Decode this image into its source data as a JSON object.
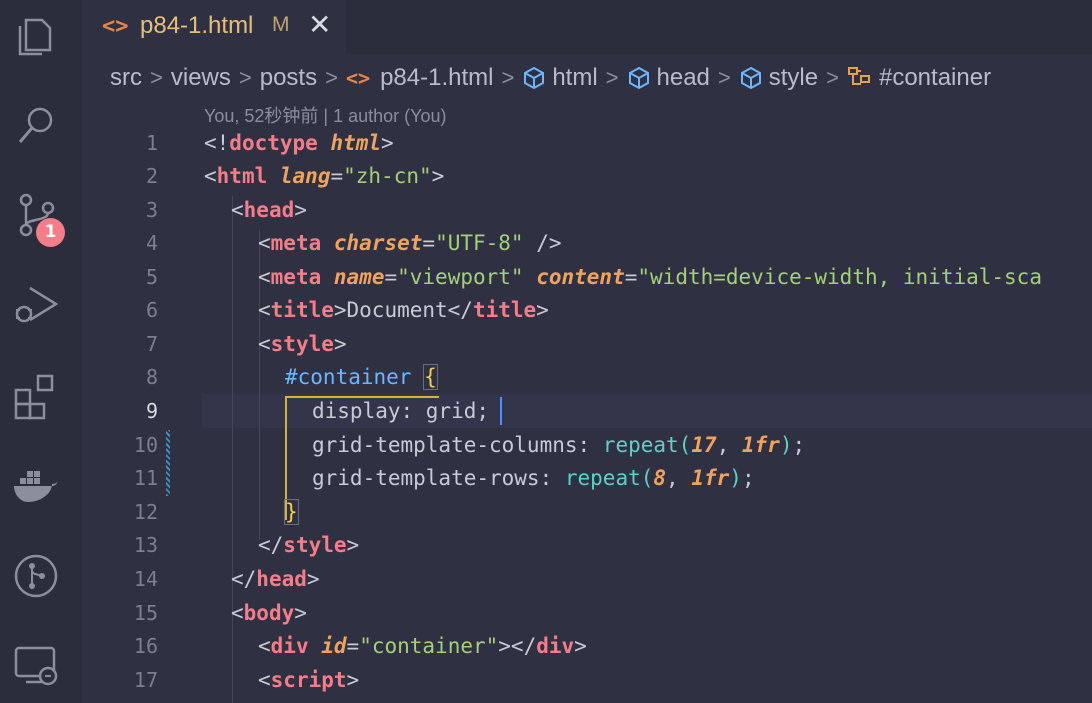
{
  "activity_bar": {
    "scm_badge": "1"
  },
  "tab": {
    "filename": "p84-1.html",
    "status": "M",
    "close": "✕",
    "file_icon": "<>"
  },
  "breadcrumb": [
    "src",
    "views",
    "posts",
    "p84-1.html",
    "html",
    "head",
    "style",
    "#container"
  ],
  "blame": "You, 52秒钟前 | 1 author (You)",
  "active_line": 9,
  "lines": [
    {
      "n": "1"
    },
    {
      "n": "2"
    },
    {
      "n": "3"
    },
    {
      "n": "4"
    },
    {
      "n": "5"
    },
    {
      "n": "6"
    },
    {
      "n": "7"
    },
    {
      "n": "8"
    },
    {
      "n": "9"
    },
    {
      "n": "10"
    },
    {
      "n": "11"
    },
    {
      "n": "12"
    },
    {
      "n": "13"
    },
    {
      "n": "14"
    },
    {
      "n": "15"
    },
    {
      "n": "16"
    },
    {
      "n": "17"
    }
  ],
  "code": {
    "l1": {
      "a": "<!",
      "b": "doctype",
      "c": " ",
      "d": "html",
      "e": ">"
    },
    "l2": {
      "a": "<",
      "b": "html",
      "c": " ",
      "d": "lang",
      "e": "=",
      "f": "\"zh-cn\"",
      "g": ">"
    },
    "l3": {
      "a": "<",
      "b": "head",
      "c": ">"
    },
    "l4": {
      "a": "<",
      "b": "meta",
      "c": " ",
      "d": "charset",
      "e": "=",
      "f": "\"UTF-8\"",
      "g": " />"
    },
    "l5": {
      "a": "<",
      "b": "meta",
      "c": " ",
      "d": "name",
      "e": "=",
      "f": "\"viewport\"",
      "g": " ",
      "h": "content",
      "i": "=",
      "j": "\"width=device-width, initial-sca"
    },
    "l6": {
      "a": "<",
      "b": "title",
      "c": ">Document</",
      "d": "title",
      "e": ">"
    },
    "l7": {
      "a": "<",
      "b": "style",
      "c": ">"
    },
    "l8": {
      "a": "#container",
      "b": " ",
      "c": "{"
    },
    "l9": {
      "a": "display: grid;"
    },
    "l10": {
      "a": "grid-template-columns: ",
      "b": "repeat",
      "c": "(",
      "d": "17",
      "e": ", ",
      "f": "1fr",
      "g": ")",
      "h": ";"
    },
    "l11": {
      "a": "grid-template-rows: ",
      "b": "repeat",
      "c": "(",
      "d": "8",
      "e": ", ",
      "f": "1fr",
      "g": ")",
      "h": ";"
    },
    "l12": {
      "a": "}"
    },
    "l13": {
      "a": "</",
      "b": "style",
      "c": ">"
    },
    "l14": {
      "a": "</",
      "b": "head",
      "c": ">"
    },
    "l15": {
      "a": "<",
      "b": "body",
      "c": ">"
    },
    "l16": {
      "a": "<",
      "b": "div",
      "c": " ",
      "d": "id",
      "e": "=",
      "f": "\"container\"",
      "g": "></",
      "h": "div",
      "i": ">"
    },
    "l17": {
      "a": "<",
      "b": "script",
      "c": ">"
    }
  },
  "colors": {
    "tag": "#f47d8a",
    "attribute": "#f0a35e",
    "string": "#a3d07a",
    "selector": "#6cb6ff",
    "function": "#5fd0c9",
    "brace": "#f5d04a"
  }
}
